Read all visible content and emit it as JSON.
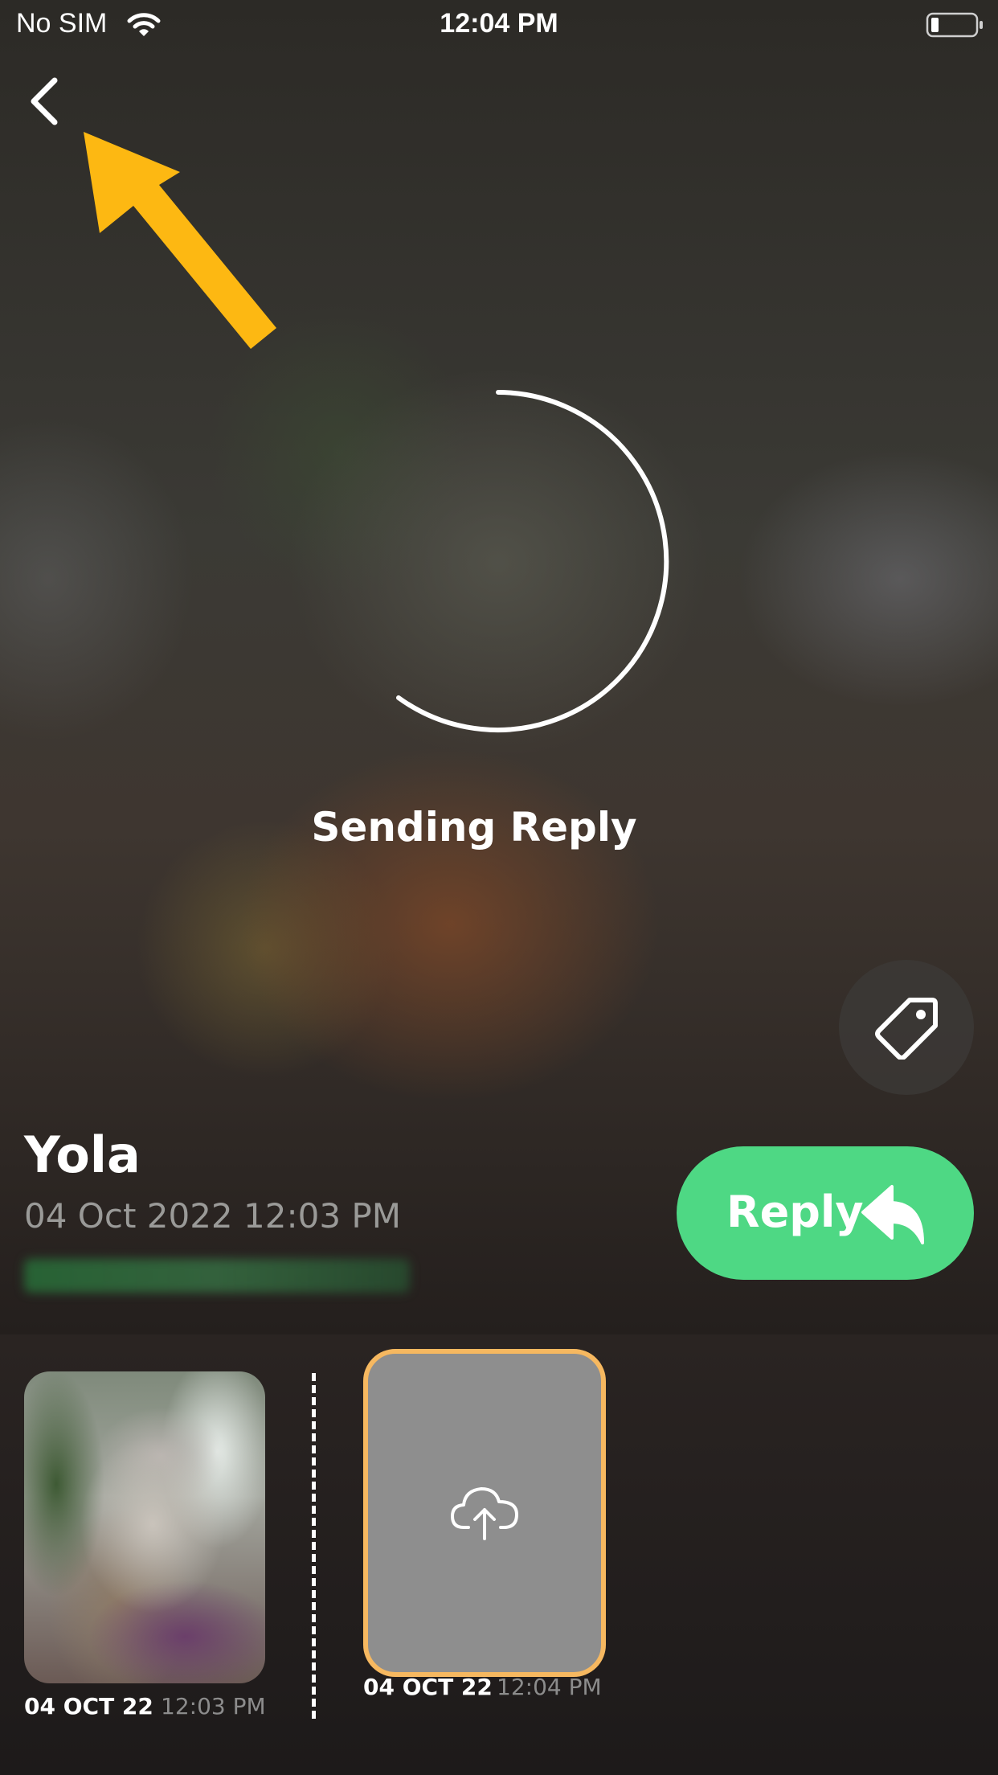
{
  "status_bar": {
    "carrier": "No SIM",
    "time": "12:04 PM"
  },
  "main": {
    "sending_text": "Sending Reply"
  },
  "message": {
    "sender_name": "Yola",
    "date": "04 Oct 2022 12:03 PM"
  },
  "actions": {
    "reply_label": "Reply"
  },
  "timeline": {
    "items": [
      {
        "date": "04 OCT 22",
        "time": "12:03 PM"
      },
      {
        "date": "04 OCT 22",
        "time": "12:04 PM"
      }
    ]
  },
  "colors": {
    "reply_green": "#4ed884",
    "annotation_arrow": "#fdb812",
    "upload_border": "#f6b860"
  },
  "icons": [
    "wifi-icon",
    "battery-icon",
    "back-chevron-icon",
    "spinner-icon",
    "tag-icon",
    "reply-arrow-icon",
    "cloud-upload-icon"
  ]
}
